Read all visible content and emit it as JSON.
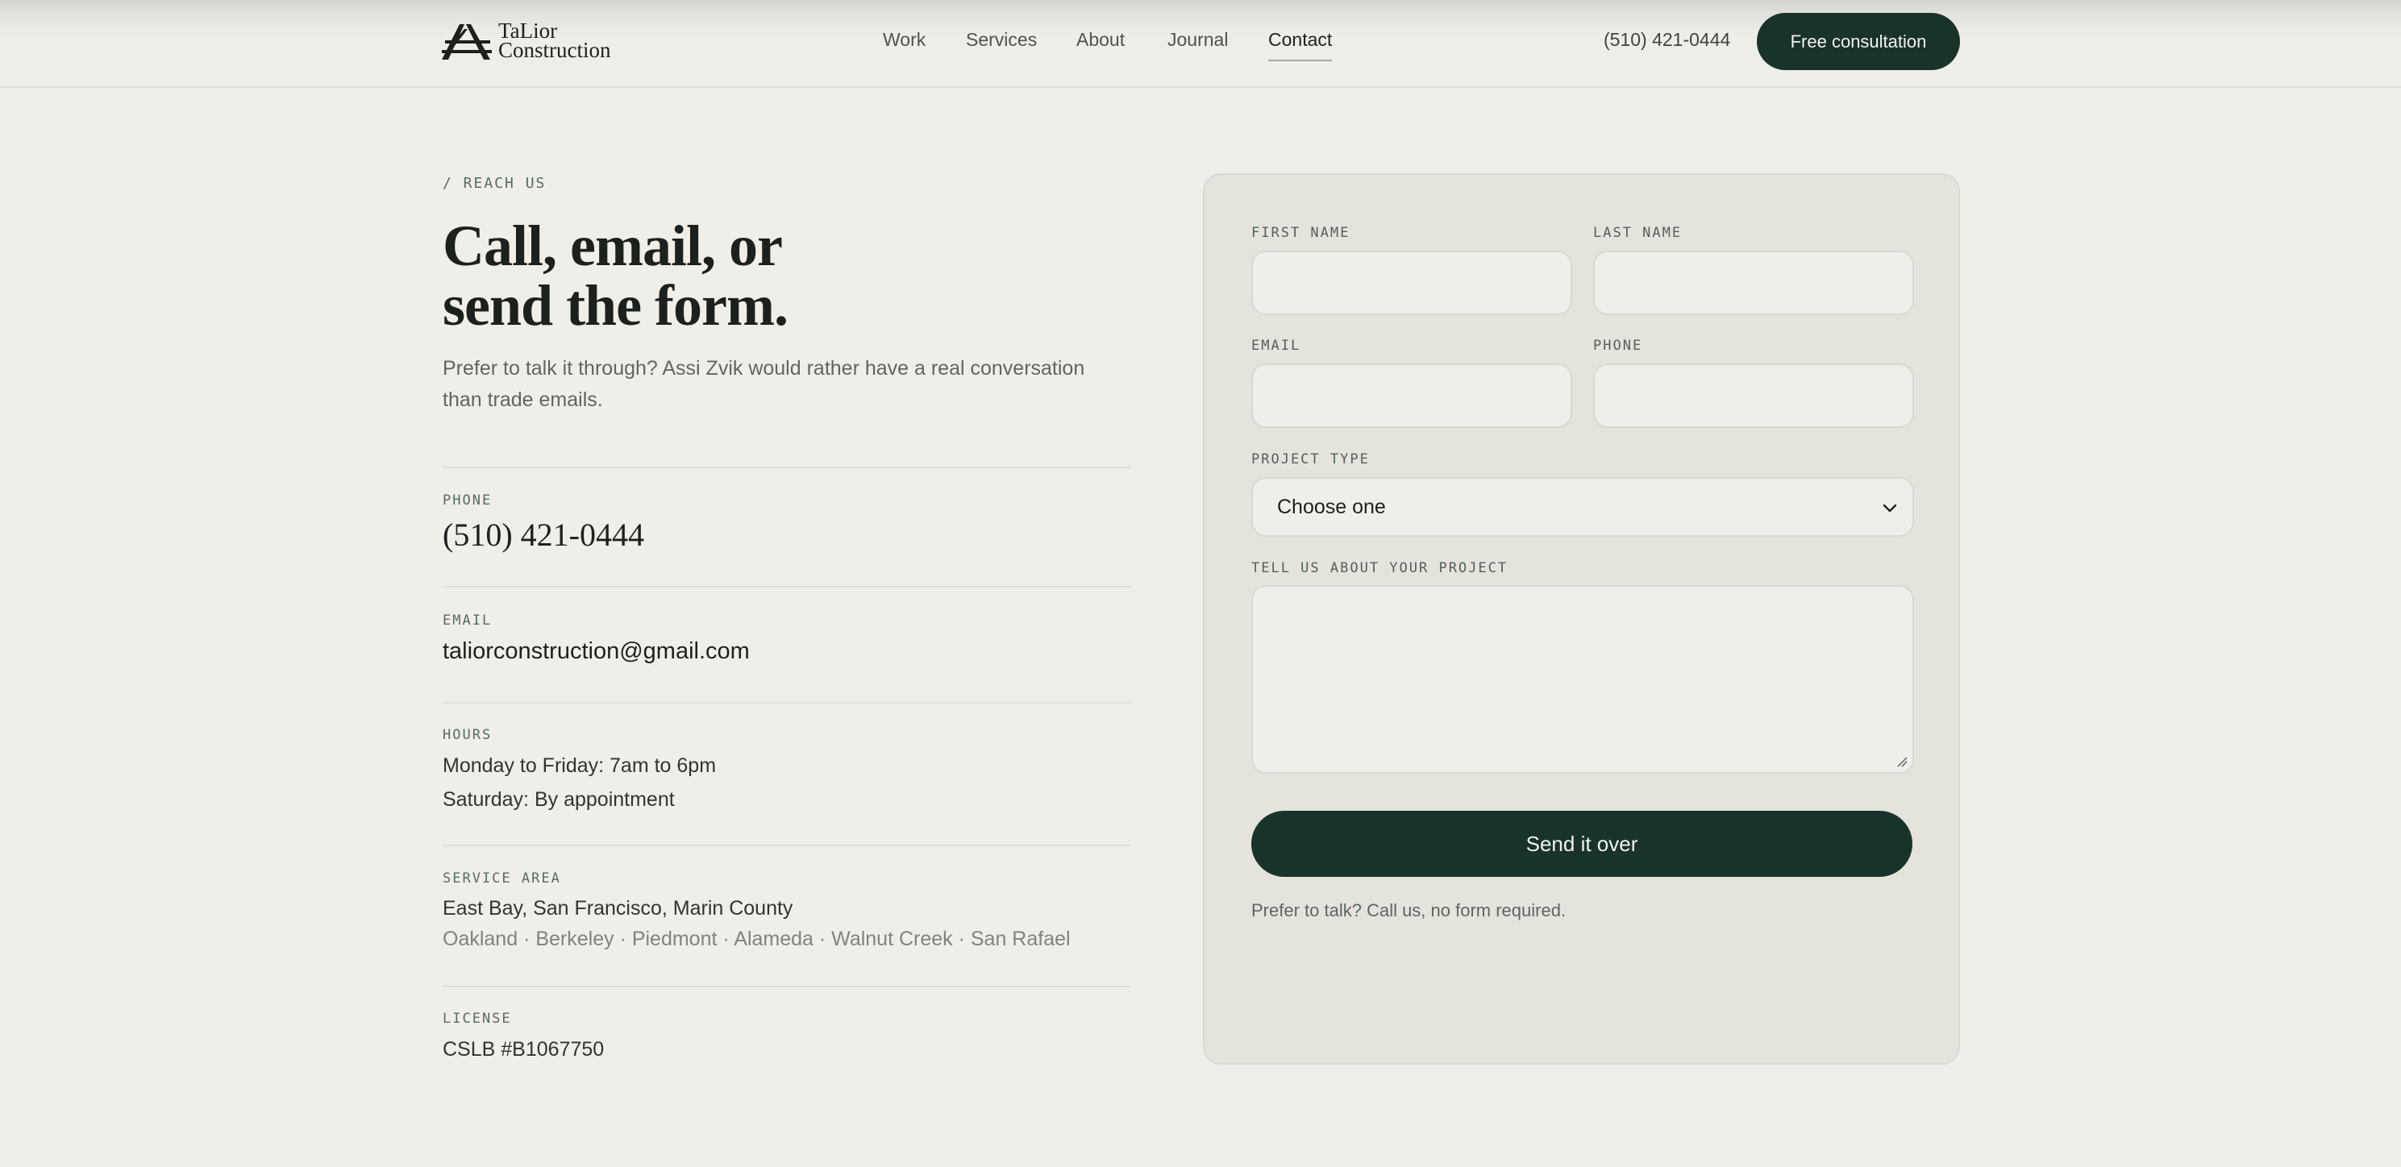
{
  "brand": {
    "line1": "TaLior",
    "line2": "Construction"
  },
  "nav": [
    {
      "label": "Work"
    },
    {
      "label": "Services"
    },
    {
      "label": "About"
    },
    {
      "label": "Journal"
    },
    {
      "label": "Contact",
      "active": true
    }
  ],
  "header": {
    "phone": "(510) 421-0444",
    "cta_label": "Free consultation"
  },
  "intro": {
    "eyebrow": "/ REACH US",
    "title_line1": "Call, email, or",
    "title_line2": "send the form.",
    "lead": "Prefer to talk it through? Assi Zvik would rather have a real conversation than trade emails."
  },
  "contact": {
    "phone_label": "PHONE",
    "phone": "(510) 421-0444",
    "email_label": "EMAIL",
    "email": "taliorconstruction@gmail.com",
    "hours_label": "HOURS",
    "hours_weekday": "Monday to Friday: 7am to 6pm",
    "hours_saturday": "Saturday: By appointment",
    "area_label": "SERVICE AREA",
    "area_primary": "East Bay, San Francisco, Marin County",
    "area_cities": "Oakland · Berkeley · Piedmont · Alameda · Walnut Creek · San Rafael",
    "license_label": "LICENSE",
    "license": "CSLB #B1067750"
  },
  "form": {
    "first_name_label": "FIRST NAME",
    "first_name_value": "",
    "last_name_label": "LAST NAME",
    "last_name_value": "",
    "email_label": "EMAIL",
    "email_value": "",
    "phone_label": "PHONE",
    "phone_value": "",
    "project_type_label": "PROJECT TYPE",
    "project_type_selected": "Choose one",
    "message_label": "TELL US ABOUT YOUR PROJECT",
    "message_value": "",
    "submit_label": "Send it over",
    "note": "Prefer to talk? Call us, no form required."
  },
  "colors": {
    "background": "#efefea",
    "card": "#e4e4dc",
    "primary": "#19332a",
    "text": "#1c211e",
    "muted": "#5f6661"
  },
  "icons": [
    "logo-mark-icon",
    "chevron-down-icon",
    "resize-handle-icon"
  ]
}
